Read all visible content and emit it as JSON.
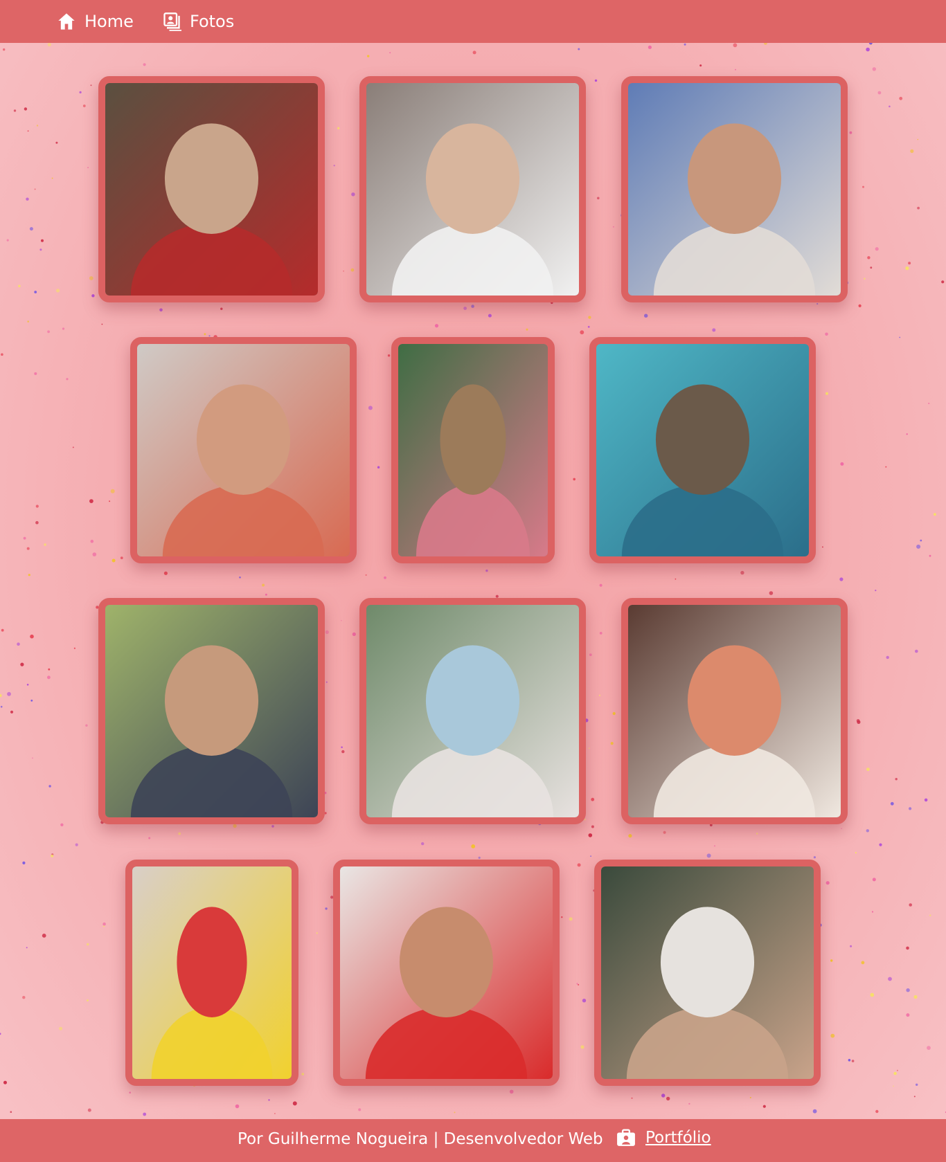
{
  "nav": {
    "home_label": "Home",
    "photos_label": "Fotos",
    "home_icon": "home-icon",
    "photos_icon": "photo-album-icon"
  },
  "gallery": {
    "photos": [
      {
        "name": "photo-1",
        "colors": [
          "#5a5040",
          "#c9a58b",
          "#b52b2b"
        ]
      },
      {
        "name": "photo-2",
        "colors": [
          "#8a7e78",
          "#d8b59d",
          "#f1f1f1"
        ]
      },
      {
        "name": "photo-3",
        "colors": [
          "#5f7cb6",
          "#c8977c",
          "#e2dcd6"
        ]
      },
      {
        "name": "photo-4",
        "colors": [
          "#cfcac6",
          "#d29b7f",
          "#d86a52"
        ]
      },
      {
        "name": "photo-5",
        "colors": [
          "#3f6d44",
          "#9c7b5a",
          "#d87a8a"
        ]
      },
      {
        "name": "photo-6",
        "colors": [
          "#4fb7c6",
          "#6b5a4a",
          "#2b6e8a"
        ]
      },
      {
        "name": "photo-7",
        "colors": [
          "#9fb36a",
          "#c69a7c",
          "#3d4456"
        ]
      },
      {
        "name": "photo-8",
        "colors": [
          "#6f8a6a",
          "#a9c8da",
          "#e8e2e0"
        ]
      },
      {
        "name": "photo-9",
        "colors": [
          "#5a3b32",
          "#dc8a6c",
          "#f0e8e0"
        ]
      },
      {
        "name": "photo-10",
        "colors": [
          "#d9cfc8",
          "#d93a3a",
          "#f1d12e"
        ]
      },
      {
        "name": "photo-11",
        "colors": [
          "#e9e6e4",
          "#c78c6d",
          "#d92b2b"
        ]
      },
      {
        "name": "photo-12",
        "colors": [
          "#3a4a3c",
          "#e6e2de",
          "#c9a38a"
        ]
      }
    ]
  },
  "footer": {
    "credit": "Por Guilherme Nogueira | Desenvolvedor Web",
    "portfolio_label": "Portfólio",
    "portfolio_icon": "portfolio-icon"
  },
  "colors": {
    "bar": "#de6566",
    "frame_border": "#dc6262",
    "background": "#f5aeb2"
  }
}
